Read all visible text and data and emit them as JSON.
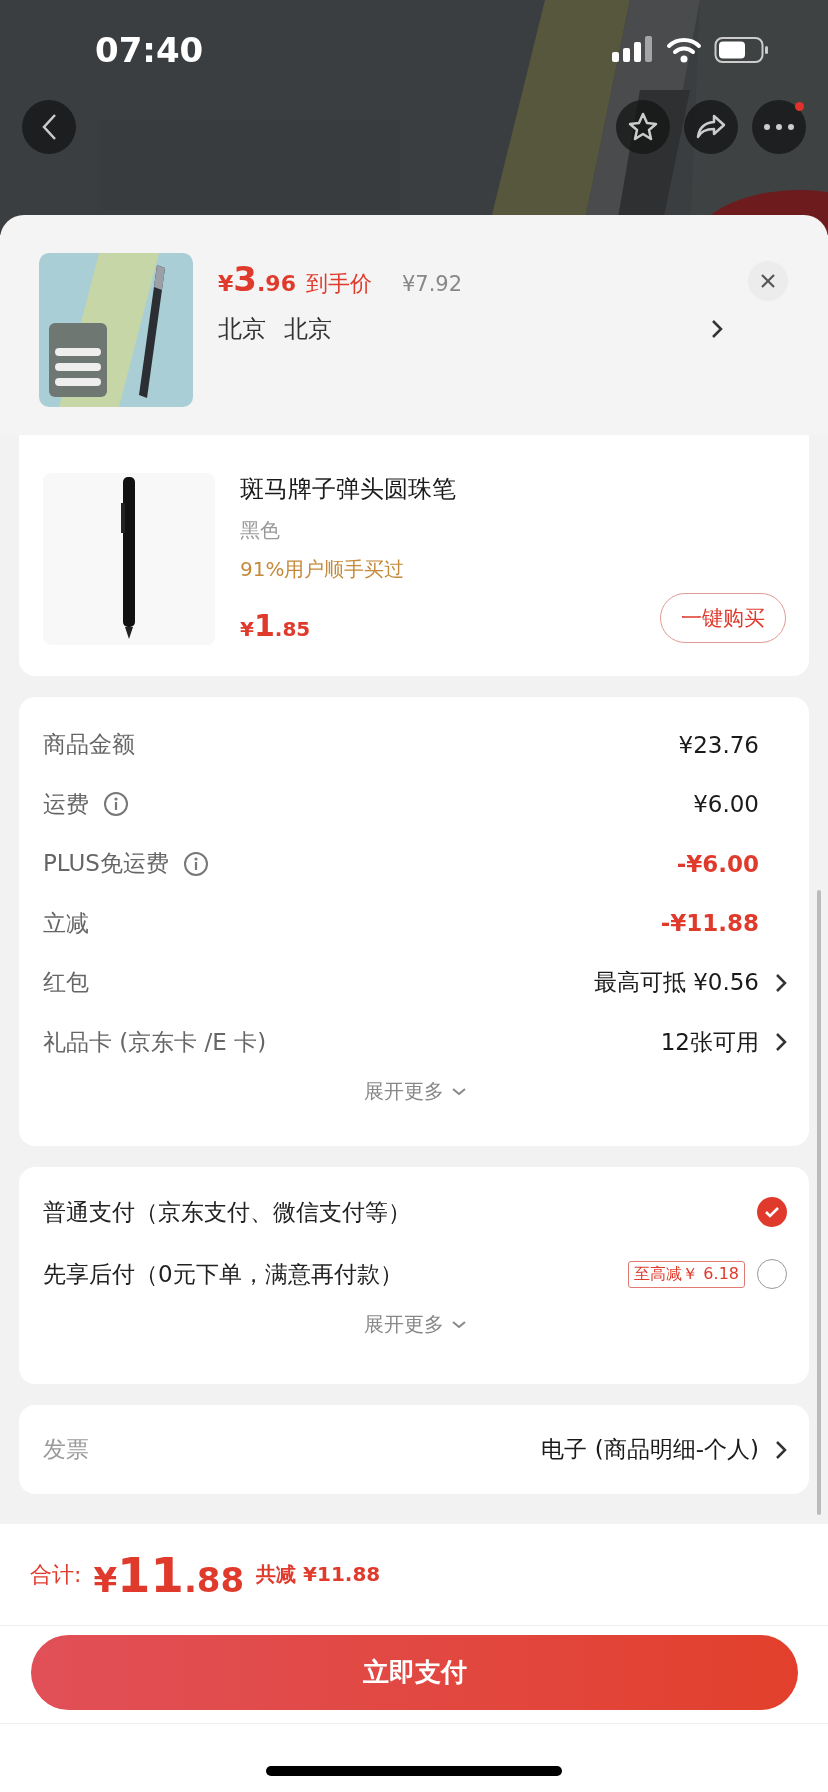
{
  "status_bar": {
    "time": "07:40"
  },
  "sheet": {
    "price": {
      "currency": "¥",
      "integer": "3",
      "decimal": ".96"
    },
    "price_label": "到手价",
    "original_price": "¥7.92",
    "location": [
      "北京",
      "北京"
    ]
  },
  "recommendation": {
    "title": "斑马牌子弹头圆珠笔",
    "variant": "黑色",
    "note": "91%用户顺手买过",
    "price": {
      "currency": "¥",
      "integer": "1",
      "decimal": ".85"
    },
    "button": "一键购买"
  },
  "fees": {
    "rows": [
      {
        "label": "商品金额",
        "info": false,
        "value": "¥23.76",
        "discount": false,
        "arrow": false
      },
      {
        "label": "运费",
        "info": true,
        "value": "¥6.00",
        "discount": false,
        "arrow": false
      },
      {
        "label": "PLUS免运费",
        "info": true,
        "value": "-¥6.00",
        "discount": true,
        "arrow": false
      },
      {
        "label": "立减",
        "info": false,
        "value": "-¥11.88",
        "discount": true,
        "arrow": false
      },
      {
        "label": "红包",
        "info": false,
        "value": "最高可抵 ¥0.56",
        "discount": false,
        "arrow": true
      },
      {
        "label": "礼品卡 (京东卡 /E 卡)",
        "info": false,
        "value": "12张可用",
        "discount": false,
        "arrow": true
      }
    ],
    "expand": "展开更多"
  },
  "payment": {
    "options": [
      {
        "label": "普通支付（京东支付、微信支付等）",
        "selected": true
      },
      {
        "label": "先享后付（0元下单，满意再付款）",
        "tag": "至高减￥ 6.18",
        "selected": false
      }
    ],
    "expand": "展开更多"
  },
  "invoice": {
    "label": "发票",
    "value": "电子 (商品明细-个人)"
  },
  "footer": {
    "total_label": "合计:",
    "total": {
      "currency": "¥",
      "integer": "11",
      "decimal": ".88"
    },
    "saving": "共减 ¥11.88",
    "pay_button": "立即支付"
  }
}
